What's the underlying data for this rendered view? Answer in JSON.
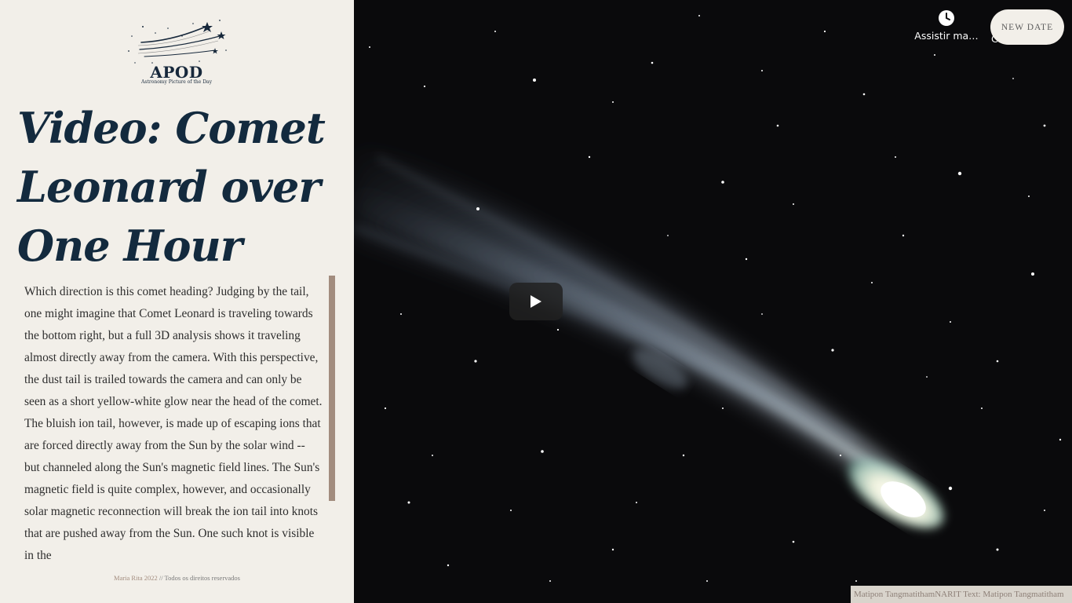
{
  "logo": {
    "title": "APOD",
    "subtitle": "Astronomy Picture of the Day"
  },
  "title_lines": [
    "Video: Comet",
    "Leonard over",
    "One Hour"
  ],
  "description": "Which direction is this comet heading? Judging by the tail, one might imagine that Comet Leonard is traveling towards the bottom right, but a full 3D analysis shows it traveling almost directly away from the camera. With this perspective, the dust tail is trailed towards the camera and can only be seen as a short yellow-white glow near the head of the comet. The bluish ion tail, however, is made up of escaping ions that are forced directly away from the Sun by the solar wind -- but channeled along the Sun's magnetic field lines. The Sun's magnetic field is quite complex, however, and occasionally solar magnetic reconnection will break the ion tail into knots that are pushed away from the Sun. One such knot is visible in the",
  "footer": {
    "author": "Maria Rita 2022",
    "rights": " // Todos os direitos reservados"
  },
  "video": {
    "watch_later_label": "Assistir ma…",
    "share_peek": "Co…",
    "new_date_label": "NEW DATE",
    "credit": "Matipon TangmatithamNARIT Text: Matipon Tangmatitham"
  },
  "colors": {
    "left_bg": "#f2efe9",
    "title": "#132a3e",
    "scrollbar": "#a28c7e"
  }
}
